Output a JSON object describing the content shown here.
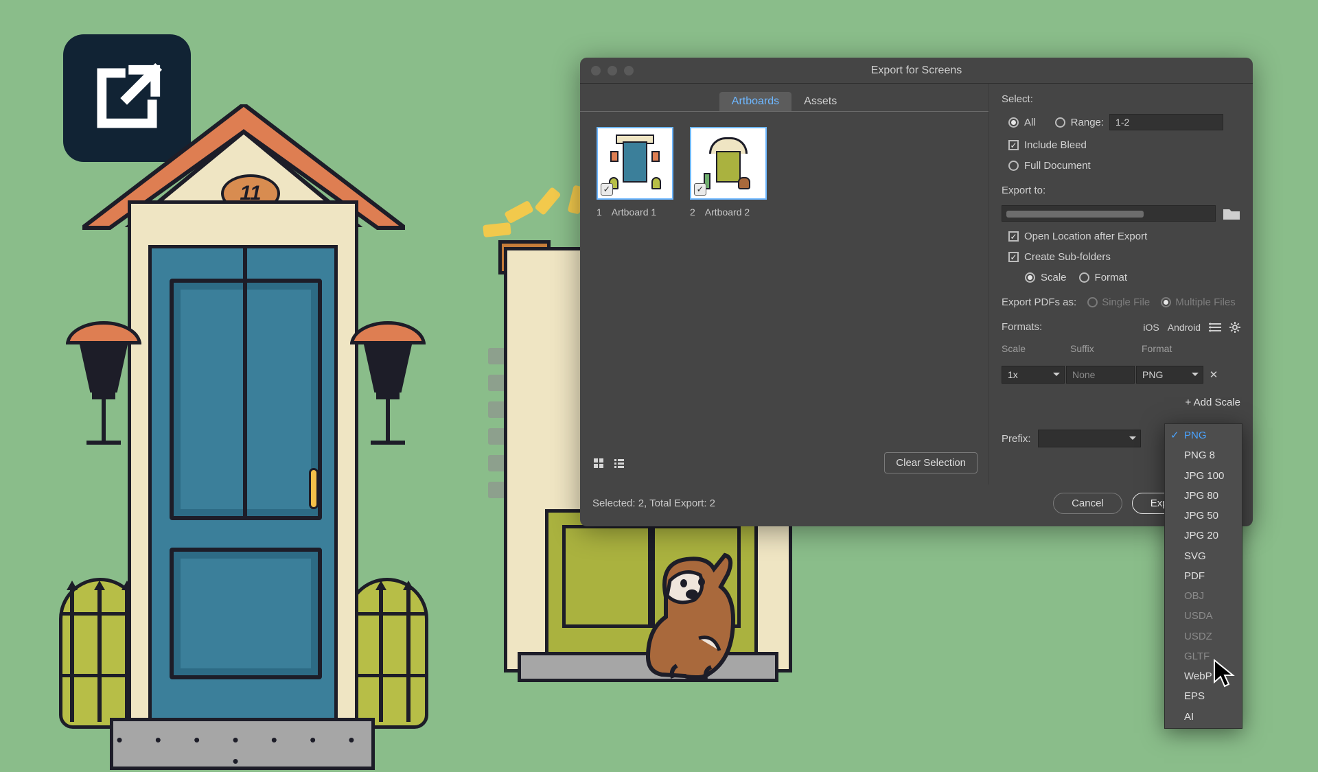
{
  "house": {
    "plaque_number": "11"
  },
  "dialog": {
    "title": "Export for Screens",
    "tabs": {
      "artboards": "Artboards",
      "assets": "Assets",
      "active": "artboards"
    },
    "thumbnails": [
      {
        "index": "1",
        "name": "Artboard 1",
        "checked": true
      },
      {
        "index": "2",
        "name": "Artboard 2",
        "checked": true
      }
    ],
    "clear_selection": "Clear Selection",
    "view_mode": "grid",
    "select": {
      "label": "Select:",
      "all": "All",
      "range_label": "Range:",
      "range_value": "1-2",
      "selected": "all",
      "include_bleed": "Include Bleed",
      "include_bleed_checked": true,
      "full_document": "Full Document",
      "full_document_selected": false
    },
    "export_to": {
      "label": "Export to:"
    },
    "open_location": {
      "label": "Open Location after Export",
      "checked": true
    },
    "create_subfolders": {
      "label": "Create Sub-folders",
      "checked": true,
      "scale": "Scale",
      "format": "Format",
      "mode": "scale"
    },
    "export_pdfs": {
      "label": "Export PDFs as:",
      "single": "Single File",
      "multiple": "Multiple Files",
      "mode": "multiple"
    },
    "formats": {
      "label": "Formats:",
      "preset_ios": "iOS",
      "preset_android": "Android",
      "col_scale": "Scale",
      "col_suffix": "Suffix",
      "col_format": "Format",
      "row": {
        "scale": "1x",
        "suffix": "None",
        "format": "PNG"
      },
      "add_scale": "+ Add Scale"
    },
    "prefix": {
      "label": "Prefix:",
      "value": ""
    },
    "status": "Selected: 2, Total Export: 2",
    "buttons": {
      "cancel": "Cancel",
      "export": "Export Artboard"
    }
  },
  "format_menu": {
    "selected": "PNG",
    "options": [
      {
        "label": "PNG",
        "enabled": true,
        "selected": true
      },
      {
        "label": "PNG 8",
        "enabled": true,
        "selected": false
      },
      {
        "label": "JPG 100",
        "enabled": true,
        "selected": false
      },
      {
        "label": "JPG 80",
        "enabled": true,
        "selected": false
      },
      {
        "label": "JPG 50",
        "enabled": true,
        "selected": false
      },
      {
        "label": "JPG 20",
        "enabled": true,
        "selected": false
      },
      {
        "label": "SVG",
        "enabled": true,
        "selected": false
      },
      {
        "label": "PDF",
        "enabled": true,
        "selected": false
      },
      {
        "label": "OBJ",
        "enabled": false,
        "selected": false
      },
      {
        "label": "USDA",
        "enabled": false,
        "selected": false
      },
      {
        "label": "USDZ",
        "enabled": false,
        "selected": false
      },
      {
        "label": "GLTF",
        "enabled": false,
        "selected": false
      },
      {
        "label": "WebP",
        "enabled": true,
        "selected": false
      },
      {
        "label": "EPS",
        "enabled": true,
        "selected": false
      },
      {
        "label": "AI",
        "enabled": true,
        "selected": false
      }
    ]
  }
}
